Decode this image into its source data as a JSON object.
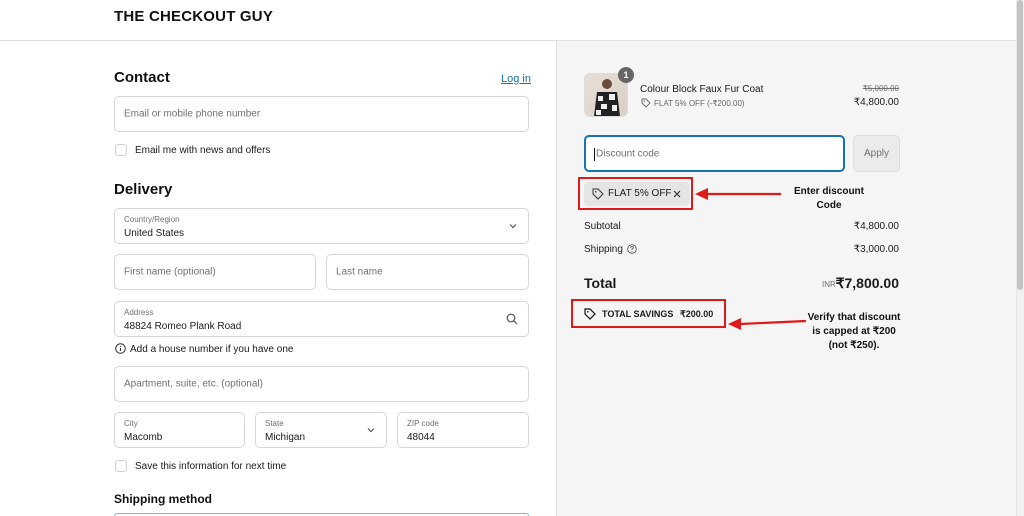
{
  "brand": "THE CHECKOUT GUY",
  "contact": {
    "heading": "Contact",
    "login_link": "Log in",
    "email_placeholder": "Email or mobile phone number",
    "newsletter_label": "Email me with news and offers"
  },
  "delivery": {
    "heading": "Delivery",
    "country_label": "Country/Region",
    "country_value": "United States",
    "first_name_placeholder": "First name (optional)",
    "last_name_placeholder": "Last name",
    "address_label": "Address",
    "address_value": "48824 Romeo Plank Road",
    "address_hint": "Add a house number if you have one",
    "apartment_placeholder": "Apartment, suite, etc. (optional)",
    "city_label": "City",
    "city_value": "Macomb",
    "state_label": "State",
    "state_value": "Michigan",
    "zip_label": "ZIP code",
    "zip_value": "48044",
    "save_info_label": "Save this information for next time",
    "shipping_method_heading": "Shipping method"
  },
  "summary": {
    "item": {
      "name": "Colour Block Faux Fur Coat",
      "quantity": "1",
      "discount_tag": "FLAT 5% OFF (-₹200.00)",
      "original_price": "₹5,000.00",
      "price": "₹4,800.00"
    },
    "discount_placeholder": "Discount code",
    "apply_label": "Apply",
    "applied_code": "FLAT 5% OFF",
    "subtotal_label": "Subtotal",
    "subtotal_value": "₹4,800.00",
    "shipping_label": "Shipping",
    "shipping_value": "₹3,000.00",
    "total_label": "Total",
    "total_currency": "INR",
    "total_value": "₹7,800.00",
    "savings_label": "TOTAL SAVINGS",
    "savings_value": "₹200.00"
  },
  "annotations": {
    "enter_code_line1": "Enter discount",
    "enter_code_line2": "Code",
    "verify_line1": "Verify that discount",
    "verify_line2": "is capped at ₹200",
    "verify_line3": "(not ₹250)."
  },
  "colors": {
    "accent": "#1773b0",
    "annotation": "#e01919",
    "summary_bg": "#f5f5f5"
  }
}
